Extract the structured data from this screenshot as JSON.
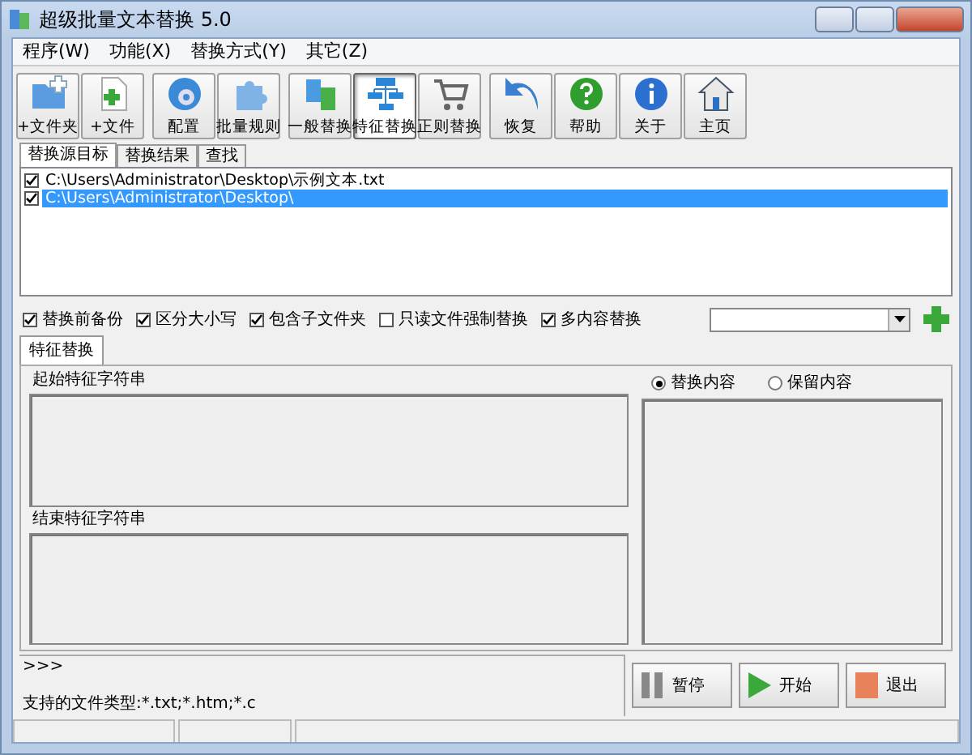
{
  "window": {
    "title": "超级批量文本替换 5.0"
  },
  "menu": [
    "程序(W)",
    "功能(X)",
    "替换方式(Y)",
    "其它(Z)"
  ],
  "toolbar": [
    {
      "label": "+文件夹",
      "selected": false
    },
    {
      "label": "+文件",
      "selected": false
    },
    {
      "label": "配置",
      "selected": false
    },
    {
      "label": "批量规则",
      "selected": false
    },
    {
      "label": "一般替换",
      "selected": false
    },
    {
      "label": "特征替换",
      "selected": true
    },
    {
      "label": "正则替换",
      "selected": false
    },
    {
      "label": "恢复",
      "selected": false
    },
    {
      "label": "帮助",
      "selected": false
    },
    {
      "label": "关于",
      "selected": false
    },
    {
      "label": "主页",
      "selected": false
    }
  ],
  "tabs": [
    {
      "label": "替换源目标",
      "selected": true
    },
    {
      "label": "替换结果",
      "selected": false
    },
    {
      "label": "查找",
      "selected": false
    }
  ],
  "targets": [
    {
      "path": "C:\\Users\\Administrator\\Desktop\\示例文本.txt",
      "checked": true,
      "selected": false
    },
    {
      "path": "C:\\Users\\Administrator\\Desktop\\",
      "checked": true,
      "selected": true
    }
  ],
  "options": [
    {
      "label": "替换前备份",
      "checked": true
    },
    {
      "label": "区分大小写",
      "checked": true
    },
    {
      "label": "包含子文件夹",
      "checked": true
    },
    {
      "label": "只读文件强制替换",
      "checked": false
    },
    {
      "label": "多内容替换",
      "checked": true
    }
  ],
  "mode_tab": {
    "label": "特征替换",
    "selected": true
  },
  "start_label": "起始特征字符串",
  "end_label": "结束特征字符串",
  "radios": [
    {
      "label": "替换内容",
      "selected": true
    },
    {
      "label": "保留内容",
      "selected": false
    }
  ],
  "log": ">>>",
  "supported": "支持的文件类型:*.txt;*.htm;*.c",
  "buttons": [
    {
      "label": "暂停",
      "kind": "pause"
    },
    {
      "label": "开始",
      "kind": "play"
    },
    {
      "label": "退出",
      "kind": "exit"
    }
  ]
}
